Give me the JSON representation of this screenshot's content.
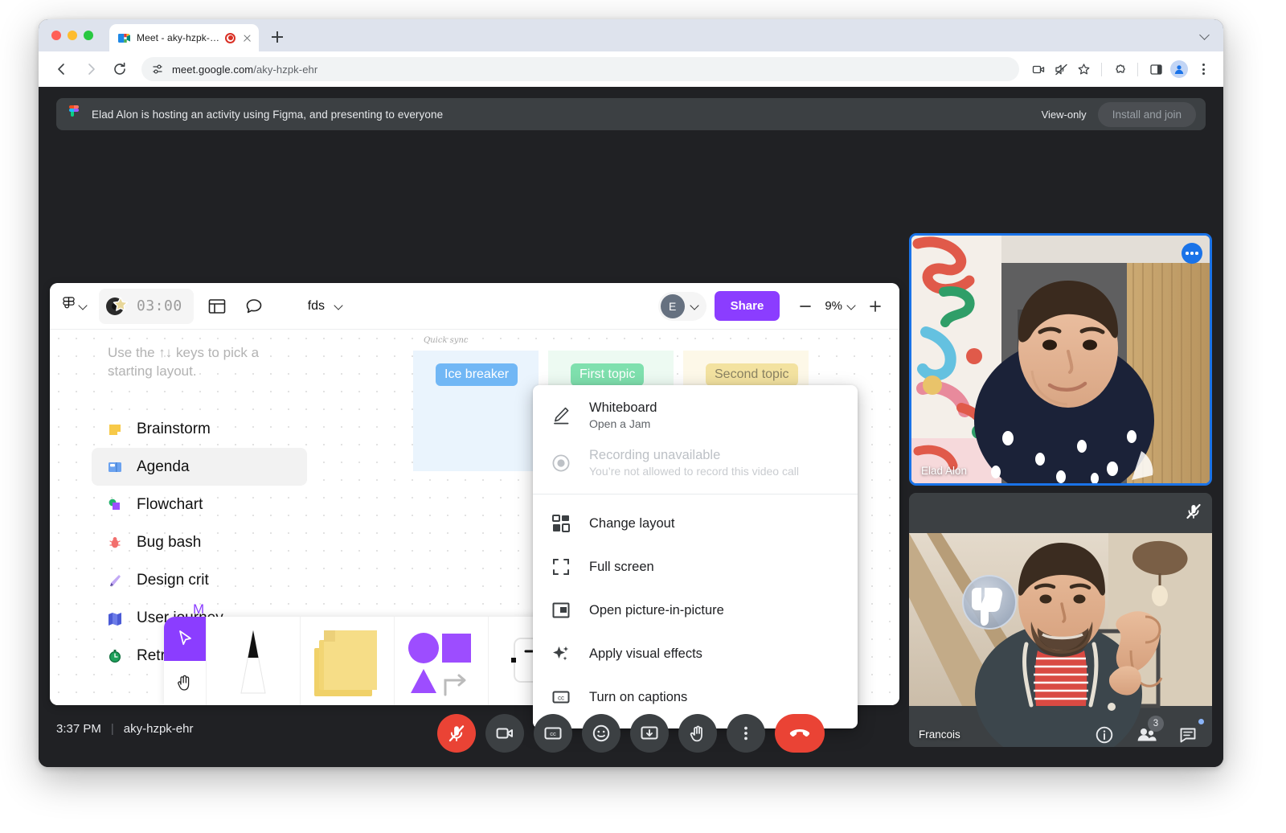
{
  "browser": {
    "tab": {
      "title": "Meet - aky-hzpk-ehr",
      "favicon_icon": "google-meet-icon",
      "recording_icon": "recording-indicator-icon",
      "close_icon": "close-icon"
    },
    "newtab_icon": "plus-icon",
    "window_chevron_icon": "chevron-down-icon",
    "nav": {
      "back_icon": "arrow-left-icon",
      "forward_icon": "arrow-right-icon",
      "reload_icon": "reload-icon"
    },
    "omnibox": {
      "site_settings_icon": "tune-icon",
      "url_host": "meet.google.com",
      "url_path": "/aky-hzpk-ehr"
    },
    "actions": [
      "camera-icon",
      "muted-speaker-icon",
      "bookmark-star-icon",
      "extensions-puzzle-icon",
      "side-panel-icon",
      "profile-avatar-icon",
      "browser-menu-kebab-icon"
    ]
  },
  "banner": {
    "app_icon": "figma-icon",
    "message": "Elad Alon is hosting an activity using Figma, and presenting to everyone",
    "view_only_label": "View-only",
    "install_button_label": "Install and join"
  },
  "figma": {
    "logo_icon": "figma-logo-icon",
    "logo_chevron_icon": "chevron-down-icon",
    "timer": {
      "emoji_icon": "star-badge-icon",
      "value": "03:00"
    },
    "toolbar_icons": [
      "panels-icon",
      "comment-bubble-icon"
    ],
    "file_name": "fds",
    "file_chevron_icon": "chevron-down-icon",
    "user_initial": "E",
    "user_chevron_icon": "chevron-down-icon",
    "share_label": "Share",
    "zoom": {
      "minus_icon": "minus-icon",
      "value": "9%",
      "chevron_icon": "chevron-down-icon",
      "plus_icon": "plus-icon"
    },
    "accent_color": "#8b3dff",
    "hint": "Use the ↑↓ keys to pick a starting layout.",
    "layouts": [
      {
        "label": "Brainstorm",
        "icon": "sticky-note-icon",
        "selected": false
      },
      {
        "label": "Agenda",
        "icon": "agenda-board-icon",
        "selected": true
      },
      {
        "label": "Flowchart",
        "icon": "flowchart-shapes-icon",
        "selected": false
      },
      {
        "label": "Bug bash",
        "icon": "bug-icon",
        "selected": false
      },
      {
        "label": "Design crit",
        "icon": "design-pen-icon",
        "selected": false
      },
      {
        "label": "User journey",
        "icon": "map-icon",
        "selected": false
      },
      {
        "label": "Retro",
        "icon": "stopwatch-icon",
        "selected": false
      }
    ],
    "more_link": "M",
    "board": {
      "title": "Quick sync",
      "columns": [
        {
          "label": "Ice breaker",
          "label_bg": "#71b7f5",
          "label_color": "#ffffff",
          "col_bg": "#eaf4fd"
        },
        {
          "label": "First topic",
          "label_bg": "#7fe0ae",
          "label_color": "#ffffff",
          "col_bg": "#edfaf2"
        },
        {
          "label": "Second topic",
          "label_bg": "#f3e2a0",
          "label_color": "#8a8263",
          "col_bg": "#fdf8e8"
        }
      ]
    },
    "tools": [
      "cursor-select-icon",
      "hand-pan-icon",
      "pen-marker-icon",
      "sticky-notes-icon",
      "shapes-icon",
      "text-tool-icon"
    ],
    "help_label": "?"
  },
  "context_menu": {
    "items": [
      {
        "icon": "pencil-whiteboard-icon",
        "title": "Whiteboard",
        "subtitle": "Open a Jam",
        "disabled": false
      },
      {
        "icon": "record-circle-icon",
        "title": "Recording unavailable",
        "subtitle": "You’re not allowed to record this video call",
        "disabled": true
      },
      {
        "icon": "change-layout-icon",
        "title": "Change layout",
        "subtitle": "",
        "disabled": false
      },
      {
        "icon": "full-screen-icon",
        "title": "Full screen",
        "subtitle": "",
        "disabled": false
      },
      {
        "icon": "picture-in-picture-icon",
        "title": "Open picture-in-picture",
        "subtitle": "",
        "disabled": false
      },
      {
        "icon": "sparkle-effects-icon",
        "title": "Apply visual effects",
        "subtitle": "",
        "disabled": false
      },
      {
        "icon": "closed-captions-icon",
        "title": "Turn on captions",
        "subtitle": "",
        "disabled": false
      }
    ]
  },
  "participants": [
    {
      "name": "Elad Alon",
      "more_icon": "more-options-icon",
      "muted": false,
      "highlighted": true
    },
    {
      "name": "Francois",
      "mute_icon": "mic-off-icon",
      "muted": true,
      "highlighted": false,
      "reaction_icon": "thumbs-down-reaction-icon"
    }
  ],
  "meet_bottom": {
    "time": "3:37 PM",
    "separator": "|",
    "meeting_code": "aky-hzpk-ehr",
    "controls": [
      {
        "icon": "mic-off-icon",
        "state": "active-red"
      },
      {
        "icon": "camera-icon",
        "state": "normal"
      },
      {
        "icon": "closed-captions-icon",
        "state": "normal"
      },
      {
        "icon": "emoji-reaction-icon",
        "state": "normal"
      },
      {
        "icon": "present-screen-icon",
        "state": "normal"
      },
      {
        "icon": "raise-hand-icon",
        "state": "normal"
      },
      {
        "icon": "more-options-kebab-icon",
        "state": "normal"
      },
      {
        "icon": "hang-up-icon",
        "state": "hangup-red"
      }
    ],
    "right": [
      {
        "icon": "meeting-details-info-icon",
        "badge": ""
      },
      {
        "icon": "people-participants-icon",
        "badge": "3"
      },
      {
        "icon": "chat-messages-icon",
        "badge": "",
        "dot": true
      }
    ]
  }
}
